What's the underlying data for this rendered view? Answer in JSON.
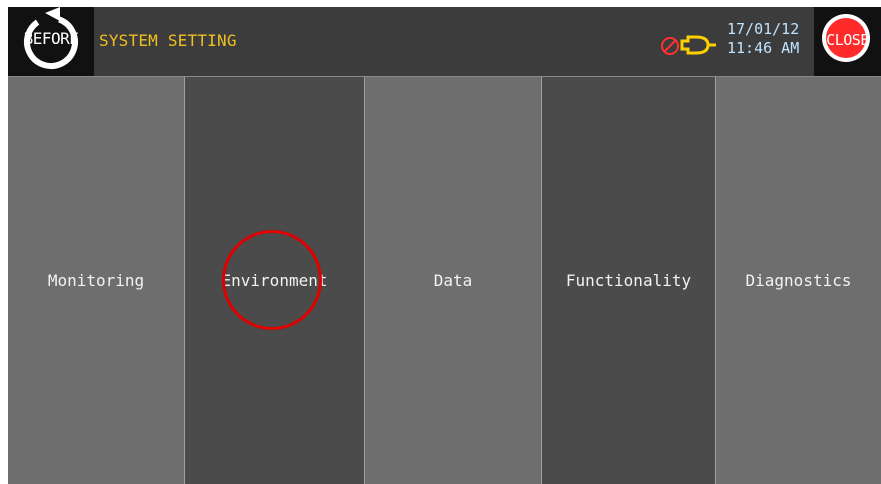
{
  "header": {
    "before_label": "BEFORE",
    "title": "SYSTEM SETTING",
    "date": "17/01/12",
    "time": "11:46 AM",
    "close_label": "CLOSE",
    "alarm_icon": "alarm-muted-icon"
  },
  "menu": {
    "items": [
      {
        "label": "Monitoring"
      },
      {
        "label": "Environment"
      },
      {
        "label": "Data"
      },
      {
        "label": "Functionality"
      },
      {
        "label": "Diagnostics"
      }
    ]
  },
  "colors": {
    "title": "#f0c020",
    "clock": "#bfe3ff",
    "close_button": "#ff2a2a",
    "highlight": "#e00000"
  }
}
